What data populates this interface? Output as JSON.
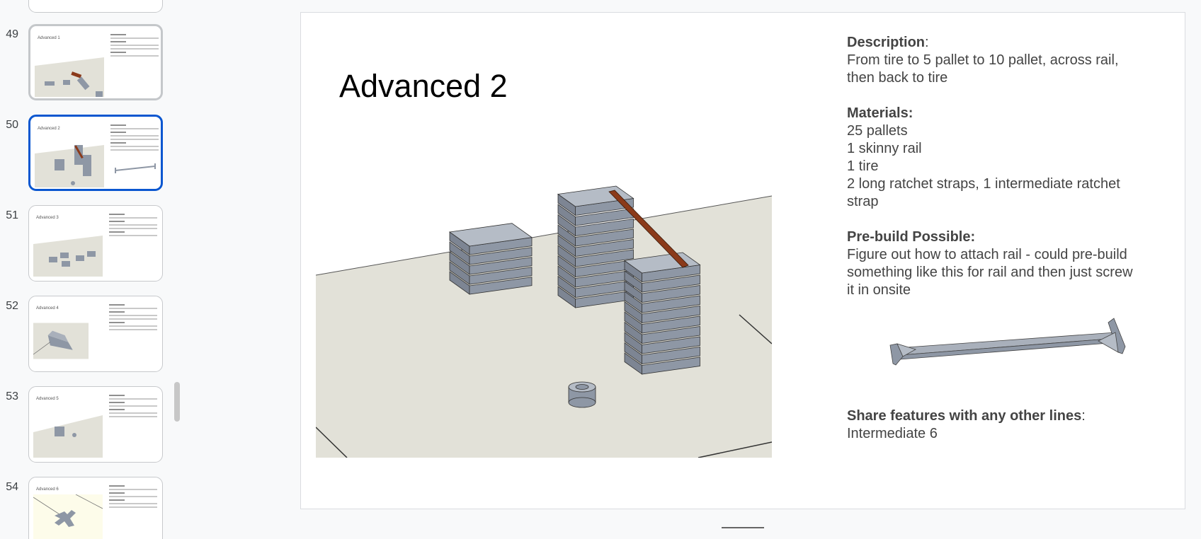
{
  "filmstrip": {
    "slides": [
      {
        "number": "49",
        "title": "Advanced 1"
      },
      {
        "number": "50",
        "title": "Advanced 2"
      },
      {
        "number": "51",
        "title": "Advanced 3"
      },
      {
        "number": "52",
        "title": "Advanced 4"
      },
      {
        "number": "53",
        "title": "Advanced 5"
      },
      {
        "number": "54",
        "title": "Advanced 6"
      }
    ],
    "selected": "50"
  },
  "slide": {
    "title": "Advanced 2",
    "description": {
      "heading": "Description",
      "colon": ":",
      "lines": [
        "From tire to 5 pallet to 10 pallet, across rail,",
        "then back to tire"
      ]
    },
    "materials": {
      "heading": "Materials:",
      "lines": [
        "25 pallets",
        "1 skinny rail",
        "1 tire",
        "2 long ratchet straps, 1 intermediate ratchet",
        "strap"
      ]
    },
    "prebuild": {
      "heading": "Pre-build Possible:",
      "lines": [
        "Figure out how to attach rail - could pre-build",
        "something like this for rail and then just screw",
        "it in onsite"
      ]
    },
    "share": {
      "heading": "Share features with any other lines",
      "colon": ":",
      "lines": [
        "Intermediate 6"
      ]
    }
  },
  "colors": {
    "accent_selected": "#0b57d0",
    "rail": "#8b3a1a",
    "pallet": "#8e97a5",
    "ground": "#e2e1d8"
  }
}
